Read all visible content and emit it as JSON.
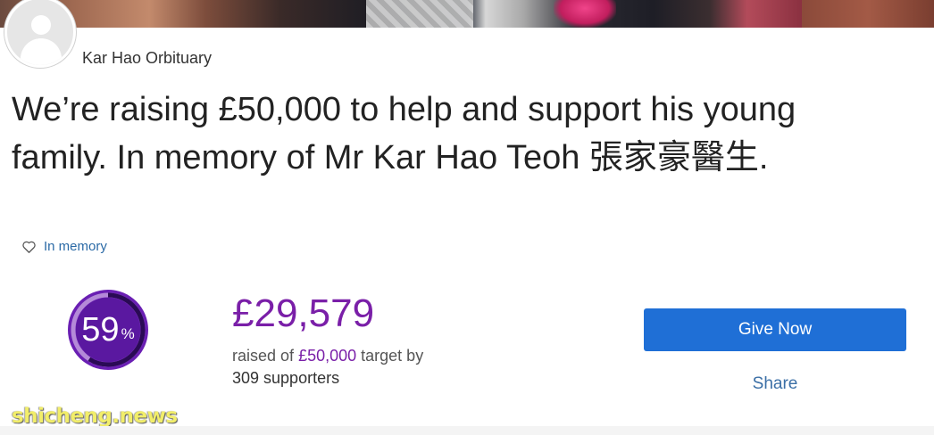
{
  "page": {
    "name": "Kar Hao Orbituary",
    "headline": "We’re raising £50,000 to help and support his young family. In memory of Mr Kar Hao Teoh 張家豪醫生.",
    "tag": "In memory"
  },
  "progress": {
    "percent": 59,
    "number_label": "59",
    "percent_symbol": "%",
    "colors": {
      "fill": "#6a1fb3",
      "track": "#b48ad8",
      "inner": "#5a18a0"
    }
  },
  "totals": {
    "raised": "£29,579",
    "raised_prefix": "raised of",
    "target": "£50,000",
    "target_suffix": "target by",
    "supporters": "309 supporters"
  },
  "actions": {
    "give_label": "Give Now",
    "share_label": "Share"
  },
  "watermark": "shicheng.news",
  "colors": {
    "accent": "#7a1fa8",
    "button": "#1f6fd6",
    "link": "#2b6aa6"
  }
}
